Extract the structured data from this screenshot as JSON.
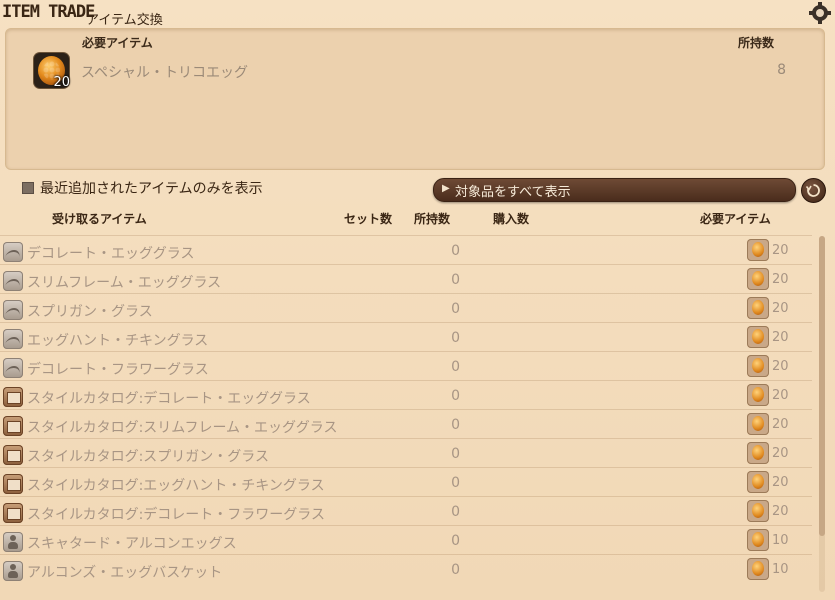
{
  "header": {
    "title": "ITEM TRADE",
    "subtitle": "アイテム交換"
  },
  "required_panel": {
    "heading_left": "必要アイテム",
    "heading_right": "所持数",
    "item": {
      "name": "スペシャル・トリコエッグ",
      "quantity": "20",
      "owned": "8",
      "icon": "egg-icon"
    }
  },
  "filter": {
    "checkbox_label": "最近追加されたアイテムのみを表示",
    "checked": true,
    "show_all_label": "対象品をすべて表示"
  },
  "table": {
    "headers": {
      "receive": "受け取るアイテム",
      "sets": "セット数",
      "owned": "所持数",
      "purchase": "購入数",
      "required": "必要アイテム"
    },
    "rows": [
      {
        "icon": "glasses-icon",
        "name": "デコレート・エッググラス",
        "owned": "0",
        "required_qty": "20"
      },
      {
        "icon": "glasses-icon",
        "name": "スリムフレーム・エッググラス",
        "owned": "0",
        "required_qty": "20"
      },
      {
        "icon": "glasses-icon",
        "name": "スプリガン・グラス",
        "owned": "0",
        "required_qty": "20"
      },
      {
        "icon": "glasses-icon",
        "name": "エッグハント・チキングラス",
        "owned": "0",
        "required_qty": "20"
      },
      {
        "icon": "glasses-icon",
        "name": "デコレート・フラワーグラス",
        "owned": "0",
        "required_qty": "20"
      },
      {
        "icon": "catalog-icon",
        "name": "スタイルカタログ:デコレート・エッググラス",
        "owned": "0",
        "required_qty": "20"
      },
      {
        "icon": "catalog-icon",
        "name": "スタイルカタログ:スリムフレーム・エッググラス",
        "owned": "0",
        "required_qty": "20"
      },
      {
        "icon": "catalog-icon",
        "name": "スタイルカタログ:スプリガン・グラス",
        "owned": "0",
        "required_qty": "20"
      },
      {
        "icon": "catalog-icon",
        "name": "スタイルカタログ:エッグハント・チキングラス",
        "owned": "0",
        "required_qty": "20"
      },
      {
        "icon": "catalog-icon",
        "name": "スタイルカタログ:デコレート・フラワーグラス",
        "owned": "0",
        "required_qty": "20"
      },
      {
        "icon": "figure-icon",
        "name": "スキャタード・アルコンエッグス",
        "owned": "0",
        "required_qty": "10"
      },
      {
        "icon": "figure-icon",
        "name": "アルコンズ・エッグバスケット",
        "owned": "0",
        "required_qty": "10"
      }
    ]
  }
}
